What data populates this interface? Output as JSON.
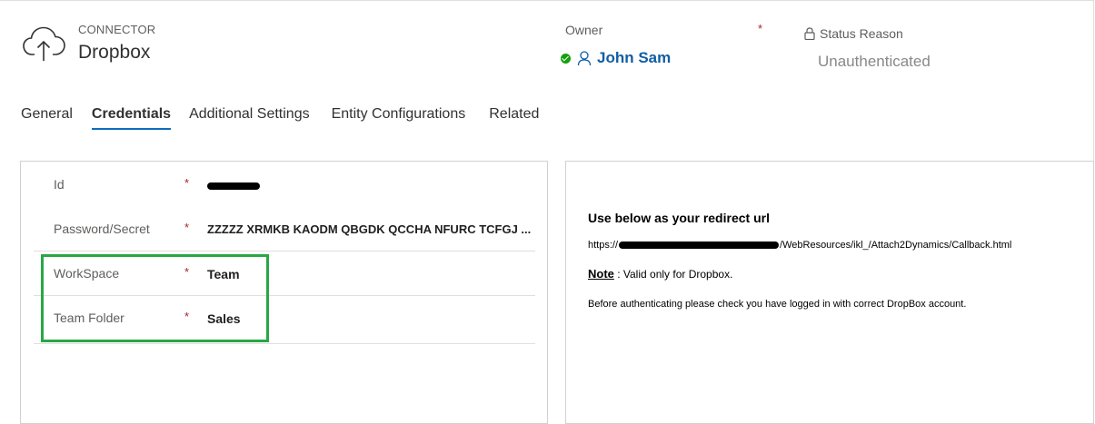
{
  "header": {
    "entity_type": "CONNECTOR",
    "entity_name": "Dropbox",
    "entity_icon": "cloud-upload-icon",
    "owner_label": "Owner",
    "owner_required": "*",
    "owner_name": "John Sam",
    "status_reason_label": "Status Reason",
    "status_reason_value": "Unauthenticated"
  },
  "tabs": [
    {
      "label": "General",
      "active": false
    },
    {
      "label": "Credentials",
      "active": true
    },
    {
      "label": "Additional Settings",
      "active": false
    },
    {
      "label": "Entity Configurations",
      "active": false
    },
    {
      "label": "Related",
      "active": false
    }
  ],
  "form": {
    "fields": [
      {
        "label": "Id",
        "required": "*",
        "value": ""
      },
      {
        "label": "Password/Secret",
        "required": "*",
        "value": "ZZZZZ XRMKB KAODM QBGDK QCCHA NFURC TCFGJ ..."
      },
      {
        "label": "WorkSpace",
        "required": "*",
        "value": "Team"
      },
      {
        "label": "Team Folder",
        "required": "*",
        "value": "Sales"
      }
    ]
  },
  "info": {
    "title": "Use below as your redirect url",
    "url_prefix": "https://",
    "url_suffix": "/WebResources/ikl_/Attach2Dynamics/Callback.html",
    "note_label": "Note",
    "note_text": " : Valid only for Dropbox.",
    "before_text": "Before authenticating please check you have logged in with correct DropBox account."
  },
  "colors": {
    "accent": "#0f6cbd",
    "link": "#115ea3",
    "required": "#a4262c",
    "highlight": "#28a745",
    "status_ok": "#13a10e"
  }
}
